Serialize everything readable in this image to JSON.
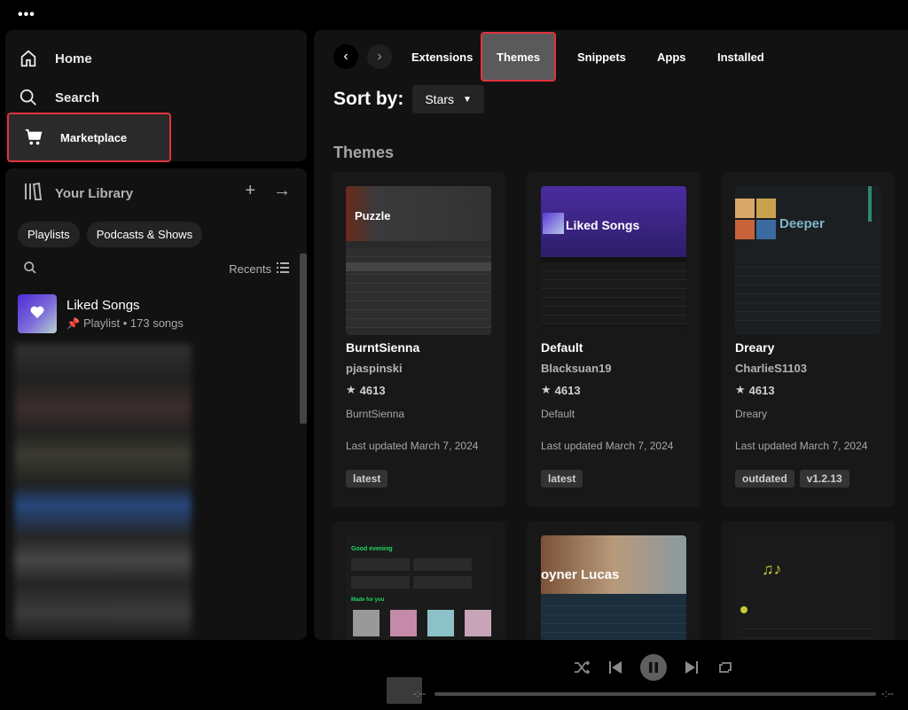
{
  "window": {
    "menu_dots": "•••"
  },
  "nav": {
    "home": "Home",
    "search": "Search",
    "marketplace": "Marketplace"
  },
  "library": {
    "title": "Your Library",
    "chips": [
      "Playlists",
      "Podcasts & Shows"
    ],
    "sort_label": "Recents",
    "liked": {
      "title": "Liked Songs",
      "subtitle": "Playlist • 173 songs"
    }
  },
  "topnav": {
    "tabs": [
      "Extensions",
      "Themes",
      "Snippets",
      "Apps",
      "Installed"
    ],
    "active_tab": "Themes"
  },
  "sort": {
    "label": "Sort by:",
    "value": "Stars"
  },
  "section_title": "Themes",
  "cards": [
    {
      "title": "BurntSienna",
      "author": "pjaspinski",
      "stars": "4613",
      "desc": "BurntSienna",
      "updated": "Last updated March 7, 2024",
      "tags": [
        "latest"
      ],
      "thumb_text": "Puzzle"
    },
    {
      "title": "Default",
      "author": "Blacksuan19",
      "stars": "4613",
      "desc": "Default",
      "updated": "Last updated March 7, 2024",
      "tags": [
        "latest"
      ],
      "thumb_text": "Liked Songs"
    },
    {
      "title": "Dreary",
      "author": "CharlieS1103",
      "stars": "4613",
      "desc": "Dreary",
      "updated": "Last updated March 7, 2024",
      "tags": [
        "outdated",
        "v1.2.13"
      ],
      "thumb_text": "Deeper"
    }
  ],
  "row2": [
    {
      "thumb_text": "Good evening",
      "sub_text": "Made for you"
    },
    {
      "thumb_text": "oyner Lucas"
    },
    {
      "thumb_text": ""
    }
  ],
  "player": {
    "time_left": "-:--",
    "time_right": "-:--"
  },
  "colors": {
    "highlight_outline": "#e0333f",
    "accent_green": "#1ed760"
  }
}
